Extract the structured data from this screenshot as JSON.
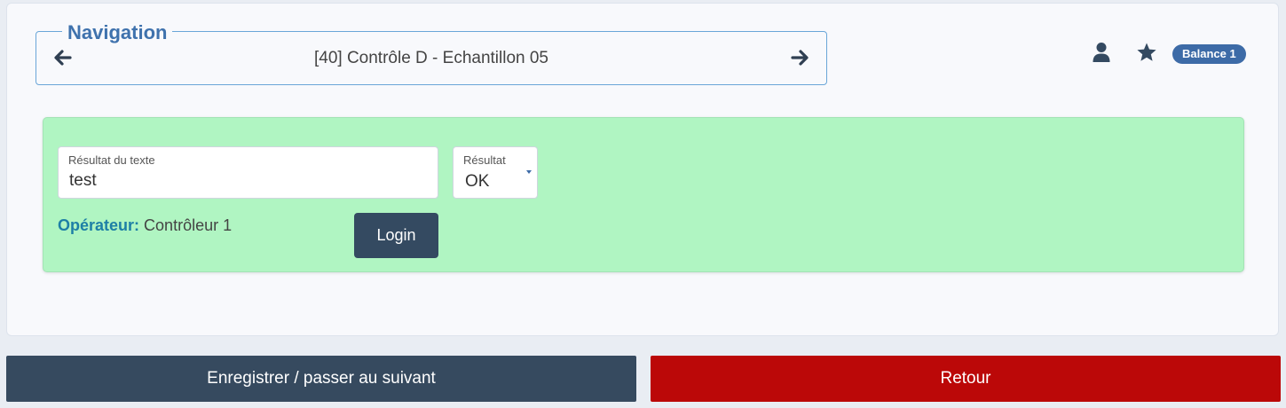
{
  "navigation": {
    "legend": "Navigation",
    "title": "[40] Contrôle D - Echantillon 05",
    "prev_icon": "arrow-left-icon",
    "next_icon": "arrow-right-icon"
  },
  "toolbar": {
    "user_icon": "user-icon",
    "star_icon": "star-icon",
    "balance_badge": "Balance 1"
  },
  "form": {
    "text_result": {
      "label": "Résultat du texte",
      "value": "test"
    },
    "result": {
      "label": "Résultat",
      "value": "OK"
    },
    "operator": {
      "label": "Opérateur:",
      "value": "Contrôleur 1"
    },
    "login_label": "Login",
    "panel_color": "#b0f5c2"
  },
  "actions": {
    "save_label": "Enregistrer / passer au suivant",
    "back_label": "Retour"
  },
  "colors": {
    "accent": "#3d6ba7",
    "dark": "#364a5f",
    "danger": "#bb0808"
  }
}
